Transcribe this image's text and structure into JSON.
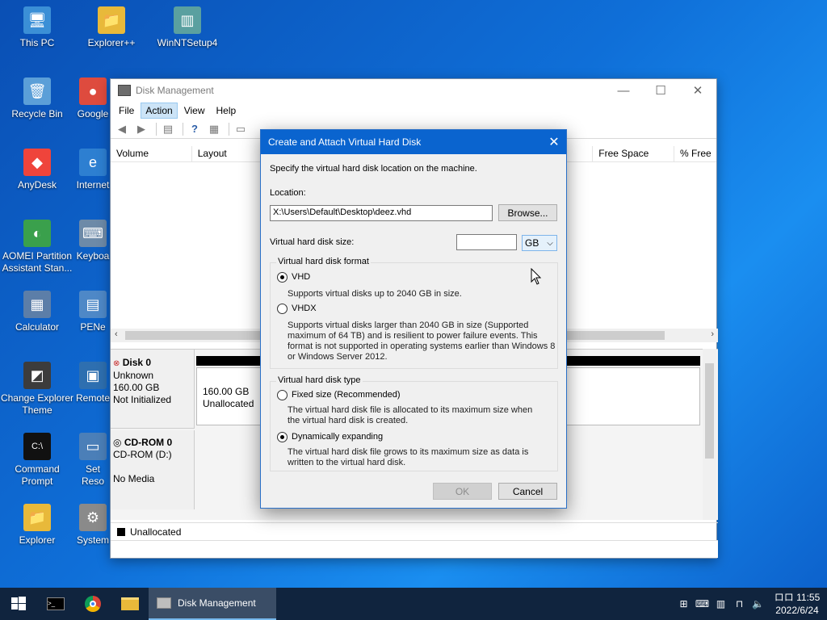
{
  "desktop": {
    "icons": [
      {
        "label": "This PC",
        "glyph": "🖥",
        "color": "#3b8fd6"
      },
      {
        "label": "Explorer++",
        "glyph": "📁",
        "color": "#e8b93a"
      },
      {
        "label": "WinNTSetup4",
        "glyph": "▥",
        "color": "#5aa0a0"
      },
      {
        "label": "Recycle Bin",
        "glyph": "🗑",
        "color": "#5b9fd8"
      },
      {
        "label": "Google",
        "glyph": "●",
        "color": "#de4b3e"
      },
      {
        "label": "AnyDesk",
        "glyph": "◆",
        "color": "#ef443b"
      },
      {
        "label": "Internet",
        "glyph": "e",
        "color": "#2d7fd1"
      },
      {
        "label": "AOMEI Partition Assistant Stan...",
        "glyph": "◐",
        "color": "#3aa04c"
      },
      {
        "label": "Keyboa",
        "glyph": "⌨",
        "color": "#6d8aa8"
      },
      {
        "label": "Calculator",
        "glyph": "▦",
        "color": "#5c7ea8"
      },
      {
        "label": "PENe",
        "glyph": "▤",
        "color": "#4e88c7"
      },
      {
        "label": "Change Explorer Theme",
        "glyph": "◩",
        "color": "#3c3c3c"
      },
      {
        "label": "Remote",
        "glyph": "▣",
        "color": "#2e6fb0"
      },
      {
        "label": "Command Prompt",
        "glyph": "C:\\",
        "color": "#111111"
      },
      {
        "label": "Set Reso",
        "glyph": "▭",
        "color": "#4b7fb8"
      },
      {
        "label": "Explorer",
        "glyph": "📁",
        "color": "#e8b93a"
      },
      {
        "label": "System",
        "glyph": "⚙",
        "color": "#8a8a8a"
      }
    ]
  },
  "window": {
    "title": "Disk Management",
    "menu": [
      "File",
      "Action",
      "View",
      "Help"
    ],
    "columns": [
      "Volume",
      "Layout",
      "Free Space",
      "% Free"
    ],
    "disks": [
      {
        "name": "Disk 0",
        "type": "Unknown",
        "size": "160.00 GB",
        "status": "Not Initialized",
        "part_size": "160.00 GB",
        "part_status": "Unallocated"
      },
      {
        "name": "CD-ROM 0",
        "type": "CD-ROM (D:)",
        "status": "No Media"
      }
    ],
    "legend": "Unallocated"
  },
  "dialog": {
    "title": "Create and Attach Virtual Hard Disk",
    "intro": "Specify the virtual hard disk location on the machine.",
    "location_label": "Location:",
    "location_value": "X:\\Users\\Default\\Desktop\\deez.vhd",
    "browse_label": "Browse...",
    "size_label": "Virtual hard disk size:",
    "size_value": "",
    "size_unit": "GB",
    "format_group": "Virtual hard disk format",
    "vhd_label": "VHD",
    "vhd_desc": "Supports virtual disks up to 2040 GB in size.",
    "vhdx_label": "VHDX",
    "vhdx_desc": "Supports virtual disks larger than 2040 GB in size (Supported maximum of 64 TB) and is resilient to power failure events. This format is not supported in operating systems earlier than Windows 8 or Windows Server 2012.",
    "type_group": "Virtual hard disk type",
    "fixed_label": "Fixed size (Recommended)",
    "fixed_desc": "The virtual hard disk file is allocated to its maximum size when the virtual hard disk is created.",
    "dynamic_label": "Dynamically expanding",
    "dynamic_desc": "The virtual hard disk file grows to its maximum size as data is written to the virtual hard disk.",
    "ok_label": "OK",
    "cancel_label": "Cancel"
  },
  "taskbar": {
    "active_task": "Disk Management",
    "time": "11:55",
    "date": "2022/6/24",
    "ime": "ロロ"
  },
  "colors": {
    "accent": "#0a64cf",
    "taskbar": "#10243e"
  }
}
